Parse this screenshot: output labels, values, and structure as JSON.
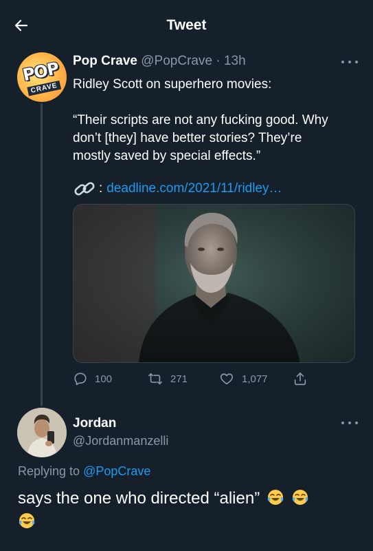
{
  "header": {
    "title": "Tweet",
    "back_icon": "arrow-left-icon"
  },
  "tweet": {
    "avatar_text_top": "POP",
    "avatar_text_bottom": "CRAVE",
    "author_name": "Pop Crave",
    "author_handle": "@PopCrave",
    "separator": "·",
    "time": "13h",
    "text_line_1": "Ridley Scott on superhero movies:",
    "text_line_2": "“Their scripts are not any fucking good. Why",
    "text_line_3": "don’t [they] have better stories? They’re",
    "text_line_4": "mostly saved by special effects.”",
    "link_emoji": "🔗",
    "link_colon": ":",
    "link_text": "deadline.com/2021/11/ridley…",
    "actions": {
      "replies": "100",
      "retweets": "271",
      "likes": "1,077"
    }
  },
  "reply": {
    "author_name": "Jordan",
    "author_handle": "@Jordanmanzelli",
    "replying_to_label": "Replying to",
    "replying_to_handle": "@PopCrave",
    "text": "says the one who directed “alien”",
    "emoji": "😂"
  },
  "colors": {
    "background": "#15202b",
    "text_primary": "#ffffff",
    "text_secondary": "#8b98a5",
    "accent": "#1d9bf0",
    "border": "#38444d"
  }
}
